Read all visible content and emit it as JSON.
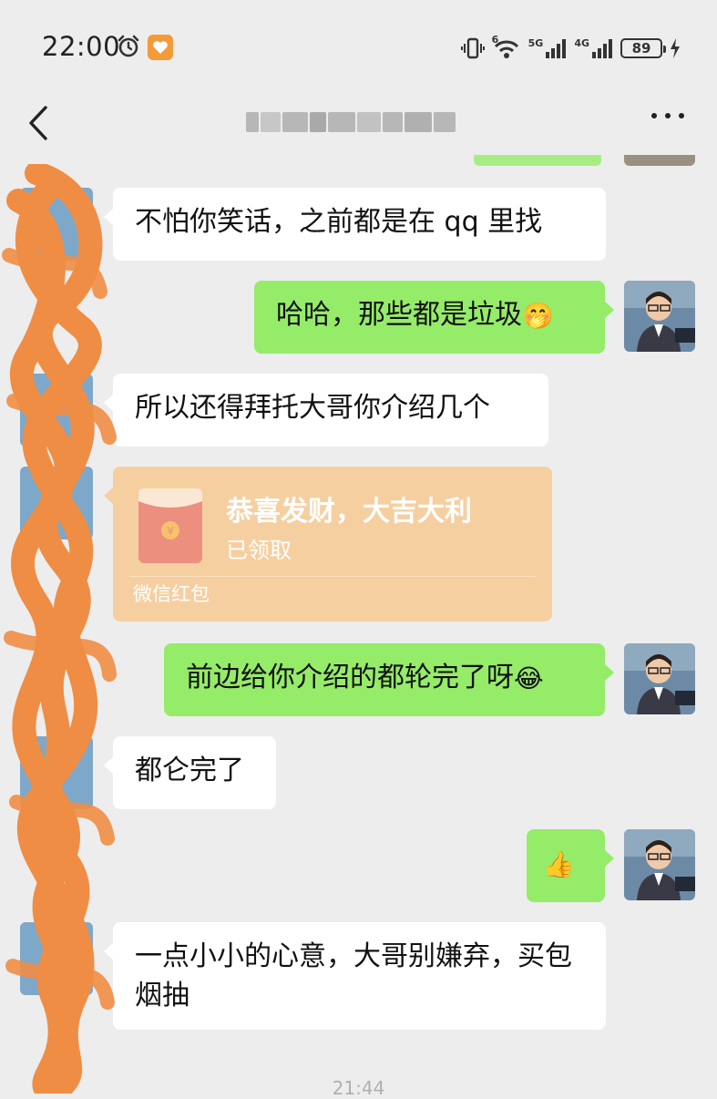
{
  "status_bar": {
    "time": "22:00",
    "network_left": "5G",
    "network_right": "4G",
    "wifi_badge": "6",
    "battery": "89"
  },
  "nav": {
    "title": "",
    "back_icon": "chevron-left-icon",
    "more_icon": "more-dots-icon"
  },
  "messages": [
    {
      "from": "other",
      "text": "不怕你笑话，之前都是在 qq 里找"
    },
    {
      "from": "me",
      "text": "哈哈，那些都是垃圾",
      "emoji": "🤭"
    },
    {
      "from": "other",
      "text": "所以还得拜托大哥你介绍几个"
    },
    {
      "from": "other",
      "type": "red_packet",
      "title": "恭喜发财，大吉大利",
      "status": "已领取",
      "footer": "微信红包"
    },
    {
      "from": "me",
      "text": "前边给你介绍的都轮完了呀",
      "emoji": "😂"
    },
    {
      "from": "other",
      "text": "都仑完了"
    },
    {
      "from": "me",
      "text": "",
      "emoji": "👍"
    },
    {
      "from": "other",
      "text": "一点小小的心意，大哥别嫌弃，买包烟抽"
    }
  ],
  "timestamp": "21:44",
  "colors": {
    "background": "#ededed",
    "bubble_out": "#95ec69",
    "bubble_in": "#ffffff",
    "red_packet": "#f6cfa1",
    "redaction": "#ef8d45"
  }
}
